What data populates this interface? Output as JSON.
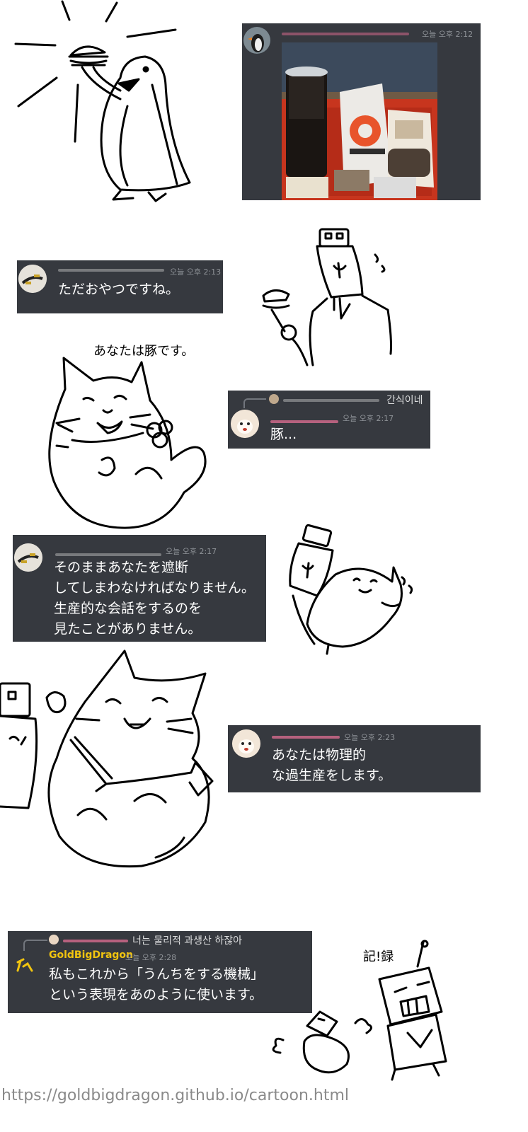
{
  "messages": {
    "m1": {
      "time": "오늘 오후 2:12"
    },
    "m2": {
      "time": "오늘 오후 2:13",
      "text": "ただおやつですね。"
    },
    "m3": {
      "reply": "간식이네",
      "time": "오늘 오후 2:17",
      "text": "豚..."
    },
    "m4": {
      "time": "오늘 오후 2:17",
      "text": "そのままあなたを遮断\nしてしまわなければなりません。\n生産的な会話をするのを\n見たことがありません。"
    },
    "m5": {
      "time": "오늘 오후 2:23",
      "text": "あなたは物理的\nな過生産をします。"
    },
    "m6": {
      "reply": "너는 물리적 과생산 하잖아",
      "name": "GoldBigDragon",
      "time": "오늘 오후 2:28",
      "text": "私もこれから「うんちをする機械」\nという表現をあのように使います。"
    }
  },
  "captions": {
    "pig": "あなたは豚です。",
    "record": "記!録"
  },
  "footer": {
    "url": "https://goldbigdragon.github.io/cartoon.html"
  },
  "colors": {
    "card_bg": "#36393f",
    "name_gold": "#f1c40f",
    "name_pink": "#d76b8f",
    "timestamp": "#8e9297"
  }
}
